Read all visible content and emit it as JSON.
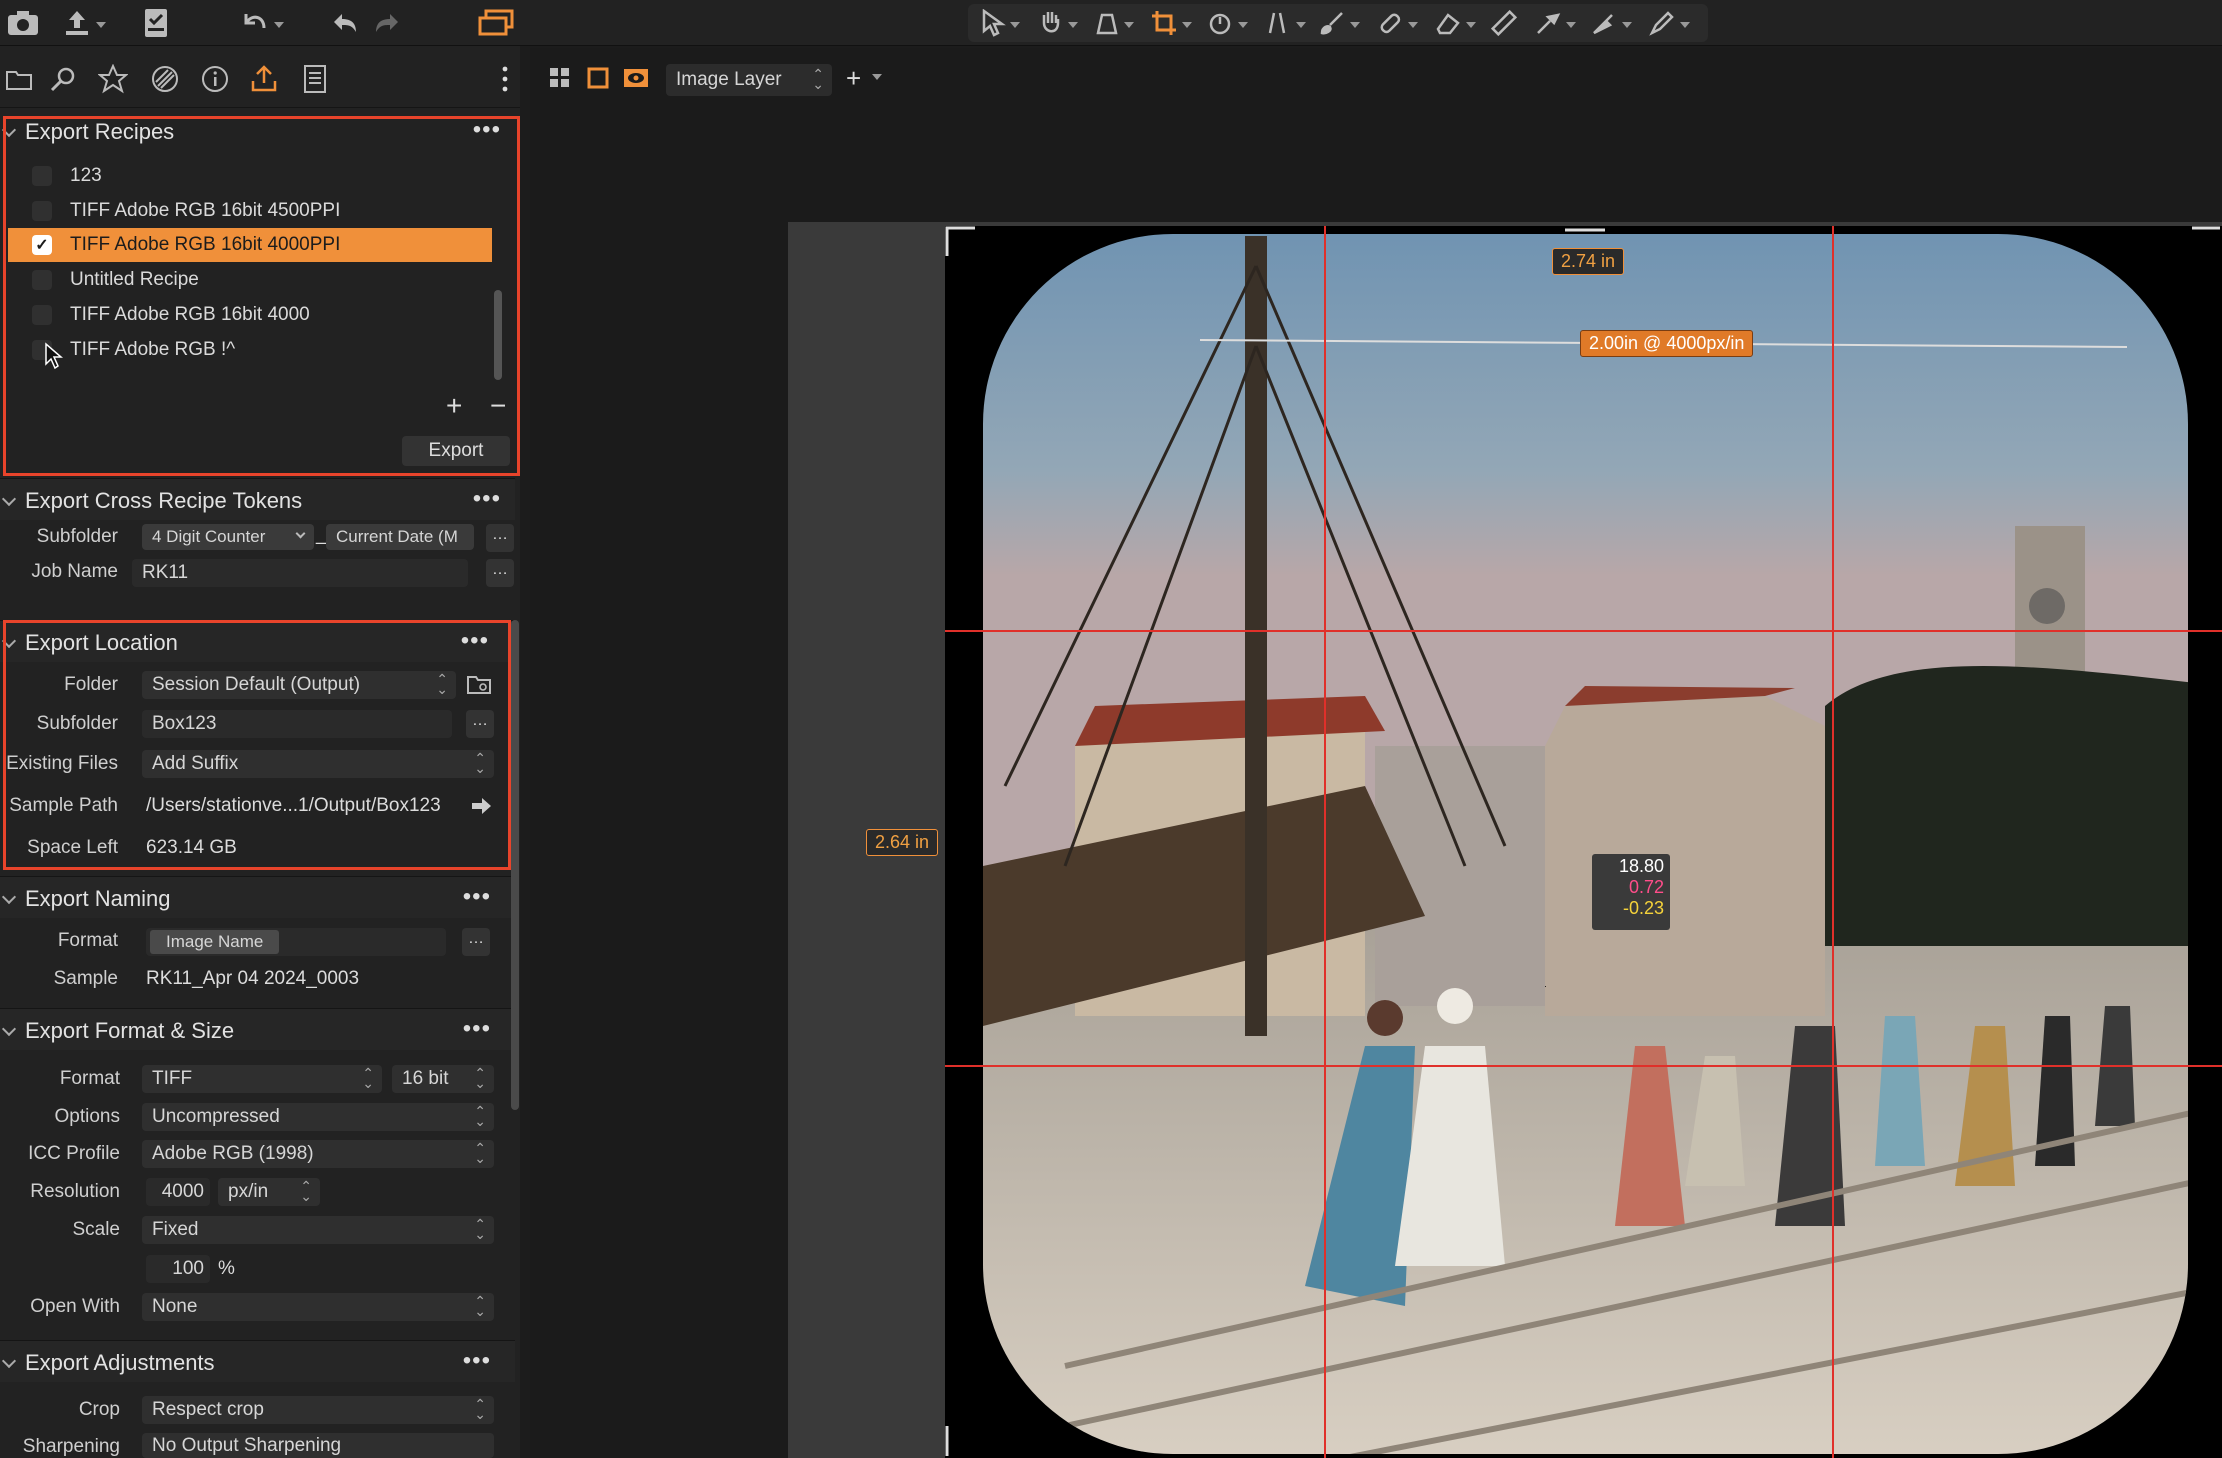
{
  "toolbar": {
    "layer_select": "Image Layer"
  },
  "colors": {
    "accent": "#f0903a",
    "highlight_box": "#e8442b",
    "guide": "#e0302a"
  },
  "export_recipes": {
    "title": "Export Recipes",
    "items": [
      {
        "label": "123",
        "checked": false
      },
      {
        "label": "TIFF Adobe RGB 16bit 4500PPI",
        "checked": false
      },
      {
        "label": "TIFF Adobe RGB 16bit 4000PPI",
        "checked": true
      },
      {
        "label": "Untitled Recipe",
        "checked": false
      },
      {
        "label": "TIFF Adobe RGB 16bit 4000",
        "checked": false
      },
      {
        "label": "TIFF Adobe RGB !^",
        "checked": false
      }
    ],
    "add": "+",
    "remove": "−",
    "export_button": "Export"
  },
  "cross_tokens": {
    "title": "Export Cross Recipe Tokens",
    "subfolder_label": "Subfolder",
    "token1": "4 Digit Counter",
    "separator": "_",
    "token2": "Current Date (M",
    "jobname_label": "Job Name",
    "jobname_value": "RK11"
  },
  "location": {
    "title": "Export Location",
    "folder_label": "Folder",
    "folder_value": "Session Default (Output)",
    "subfolder_label": "Subfolder",
    "subfolder_value": "Box123",
    "existing_label": "Existing Files",
    "existing_value": "Add Suffix",
    "sample_label": "Sample Path",
    "sample_value": "/Users/stationve...1/Output/Box123",
    "space_label": "Space Left",
    "space_value": "623.14 GB"
  },
  "naming": {
    "title": "Export Naming",
    "format_label": "Format",
    "format_token": "Image Name",
    "sample_label": "Sample",
    "sample_value": "RK11_Apr 04 2024_0003"
  },
  "format_size": {
    "title": "Export Format & Size",
    "format_label": "Format",
    "format_value": "TIFF",
    "bit_value": "16 bit",
    "options_label": "Options",
    "options_value": "Uncompressed",
    "icc_label": "ICC Profile",
    "icc_value": "Adobe RGB (1998)",
    "resolution_label": "Resolution",
    "resolution_value": "4000",
    "resolution_unit": "px/in",
    "scale_label": "Scale",
    "scale_value": "Fixed",
    "scale_percent": "100",
    "percent_sign": "%",
    "openwith_label": "Open With",
    "openwith_value": "None"
  },
  "adjustments": {
    "title": "Export Adjustments",
    "crop_label": "Crop",
    "crop_value": "Respect crop",
    "sharpen_label": "Sharpening",
    "sharpen_value": "No Output Sharpening"
  },
  "viewer": {
    "width_badge": "2.74 in",
    "height_badge": "2.64 in",
    "measure_badge": "2.00in @ 4000px/in",
    "readout_1": "18.80",
    "readout_2": "0.72",
    "readout_3": "-0.23"
  }
}
